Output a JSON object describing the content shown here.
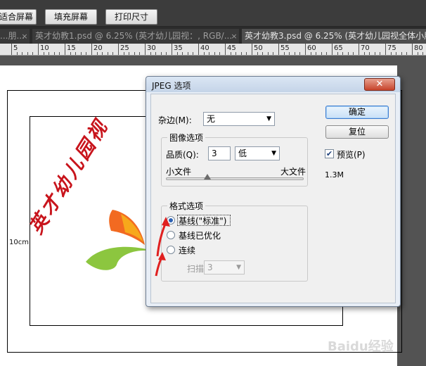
{
  "options_bar": {
    "buttons": [
      "适合屏幕",
      "填充屏幕",
      "打印尺寸"
    ]
  },
  "tabs": [
    {
      "label": "...朋...",
      "active": false
    },
    {
      "label": "英才幼教1.psd @ 6.25% (英才幼儿园视：, RGB/...",
      "active": false
    },
    {
      "label": "英才幼教3.psd @ 6.25% (英才幼儿园视全体小朋",
      "active": true
    }
  ],
  "tab_close_glyph": "×",
  "ruler": {
    "labels": [
      "5",
      "10",
      "15",
      "20",
      "25",
      "30",
      "35",
      "40",
      "45",
      "50",
      "55",
      "60",
      "65",
      "70",
      "75",
      "80"
    ]
  },
  "canvas": {
    "dimension_label": "10cm",
    "calligraphy_text": "英才幼儿园视",
    "watermark": "Baidu经验",
    "logo_colors": [
      "#f26a21",
      "#f7a81b",
      "#8cc63f"
    ]
  },
  "dialog": {
    "title": "JPEG 选项",
    "close_glyph": "✕",
    "matte": {
      "label": "杂边(M):",
      "value": "无"
    },
    "image_options": {
      "title": "图像选项",
      "quality_label": "品质(Q):",
      "quality_value": "3",
      "quality_preset": "低",
      "small_file_label": "小文件",
      "large_file_label": "大文件",
      "slider_position": 0.3
    },
    "format_options": {
      "title": "格式选项",
      "options": [
        {
          "label": "基线(\"标准\")",
          "selected": true
        },
        {
          "label": "基线已优化",
          "selected": false
        },
        {
          "label": "连续",
          "selected": false
        }
      ],
      "scans_label": "扫描:",
      "scans_value": "3"
    },
    "buttons": {
      "ok": "确定",
      "reset": "复位"
    },
    "preview": {
      "label": "预览(P)",
      "checked": true
    },
    "file_size": "1.3M"
  },
  "colors": {
    "ps_background": "#535353",
    "dialog_default_button": "#3d7bcf",
    "annotation_red": "#e02020",
    "calligraphy_red": "#c8141c"
  }
}
